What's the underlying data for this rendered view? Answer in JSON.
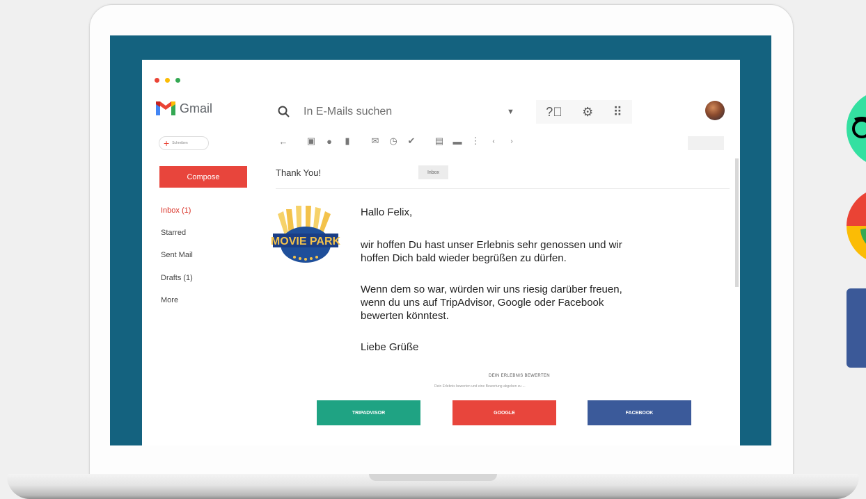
{
  "window_title": "Gmail",
  "search": {
    "placeholder": "In E-Mails suchen"
  },
  "compose_pill_label": "Schreiben",
  "sidebar": {
    "compose_label": "Compose",
    "items": [
      {
        "label": "Inbox (1)",
        "active": true
      },
      {
        "label": "Starred"
      },
      {
        "label": "Sent Mail"
      },
      {
        "label": "Drafts (1)"
      },
      {
        "label": "More"
      }
    ]
  },
  "toolbar_icons": [
    "back-arrow-icon",
    "archive-icon",
    "report-spam-icon",
    "delete-icon",
    "mark-unread-icon",
    "snooze-icon",
    "add-task-icon",
    "move-to-icon",
    "label-icon",
    "more-vert-icon",
    "prev-icon",
    "next-icon"
  ],
  "email": {
    "subject": "Thank You!",
    "tag": "Inbox",
    "sender_logo": "MOVIE PARK",
    "greeting": "Hallo Felix,",
    "para1_line1": "wir hoffen Du hast unser Erlebnis sehr genossen und wir",
    "para1_line2": "hoffen Dich bald wieder begrüßen zu dürfen.",
    "para2_line1": "Wenn dem so war, würden wir uns riesig darüber freuen,",
    "para2_line2": "wenn du uns auf TripAdvisor, Google oder Facebook",
    "para2_line3": "bewerten könntest.",
    "closing": "Liebe Grüße",
    "rate_title": "DEIN ERLEBNIS BEWERTEN",
    "rate_sub": "Dein Erlebnis bewerten und eine Bewertung abgeben zu ...",
    "buttons": [
      {
        "label": "TRIPADVISOR",
        "color": "#1fa383"
      },
      {
        "label": "GOOGLE",
        "color": "#e8453c"
      },
      {
        "label": "FACEBOOK",
        "color": "#3b5a9a"
      }
    ]
  },
  "colors": {
    "screen_bg": "#14627f",
    "compose": "#e8453c",
    "active_nav": "#d93025"
  }
}
